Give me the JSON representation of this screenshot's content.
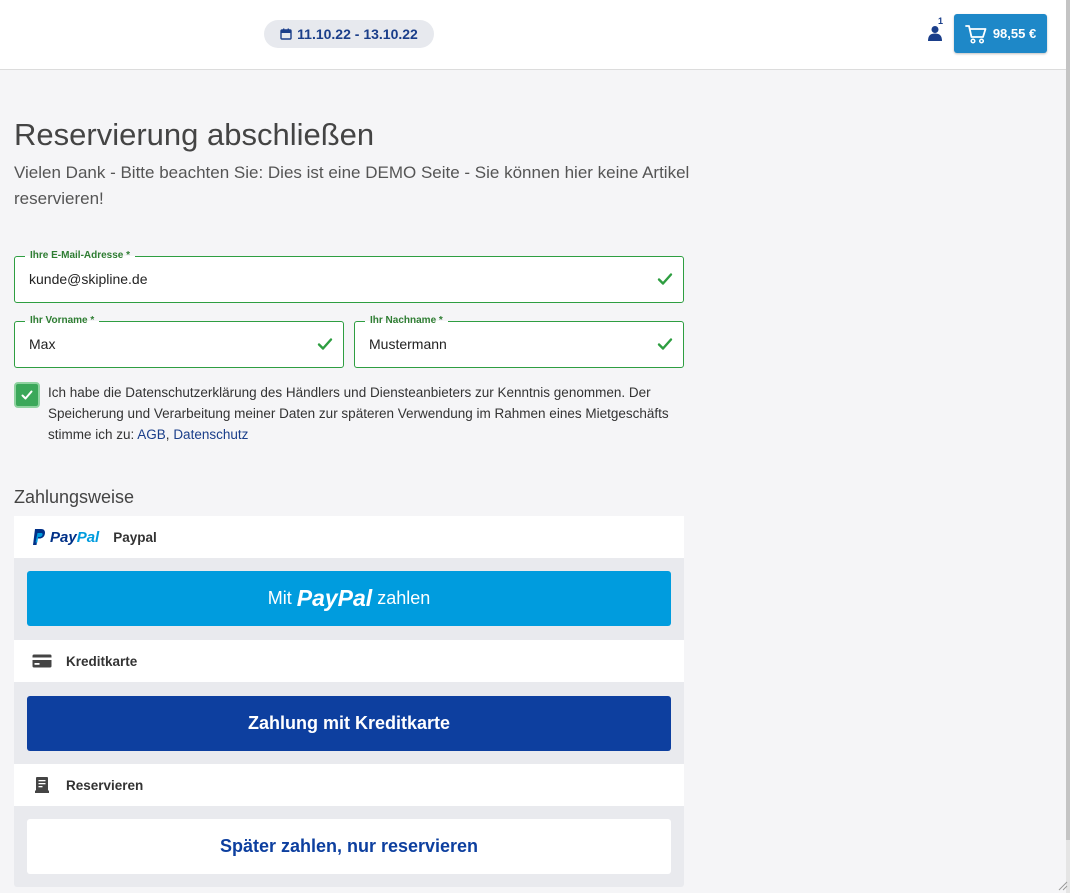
{
  "header": {
    "date_range": "11.10.22 - 13.10.22",
    "user_badge_count": "1",
    "cart_total": "98,55 €"
  },
  "main": {
    "title": "Reservierung abschließen",
    "subtitle": "Vielen Dank - Bitte beachten Sie: Dies ist eine DEMO Seite - Sie können hier keine Artikel reservieren!"
  },
  "form": {
    "email": {
      "label": "Ihre E-Mail-Adresse *",
      "value": "kunde@skipline.de"
    },
    "firstname": {
      "label": "Ihr Vorname *",
      "value": "Max"
    },
    "lastname": {
      "label": "Ihr Nachname *",
      "value": "Mustermann"
    },
    "consent": {
      "checked": true,
      "text": "Ich habe die Datenschutzerklärung des Händlers und Diensteanbieters zur Kenntnis genommen. Der Speicherung und Verarbeitung meiner Daten zur späteren Verwendung im Rahmen eines Mietgeschäfts stimme ich zu: ",
      "agb_link": "AGB",
      "separator": ", ",
      "privacy_link": "Datenschutz"
    }
  },
  "payment": {
    "heading": "Zahlungsweise",
    "paypal": {
      "logo_part1": "Pay",
      "logo_part2": "Pal",
      "label": "Paypal",
      "button_prefix": "Mit",
      "button_brand": "PayPal",
      "button_suffix": "zahlen"
    },
    "creditcard": {
      "label": "Kreditkarte",
      "button": "Zahlung mit Kreditkarte"
    },
    "reserve": {
      "label": "Reservieren",
      "button": "Später zahlen, nur reservieren"
    }
  },
  "colors": {
    "accent_blue": "#1e88c8",
    "navy": "#0d3f9f",
    "paypal_blue": "#009cde",
    "valid_green": "#2e9e41"
  }
}
